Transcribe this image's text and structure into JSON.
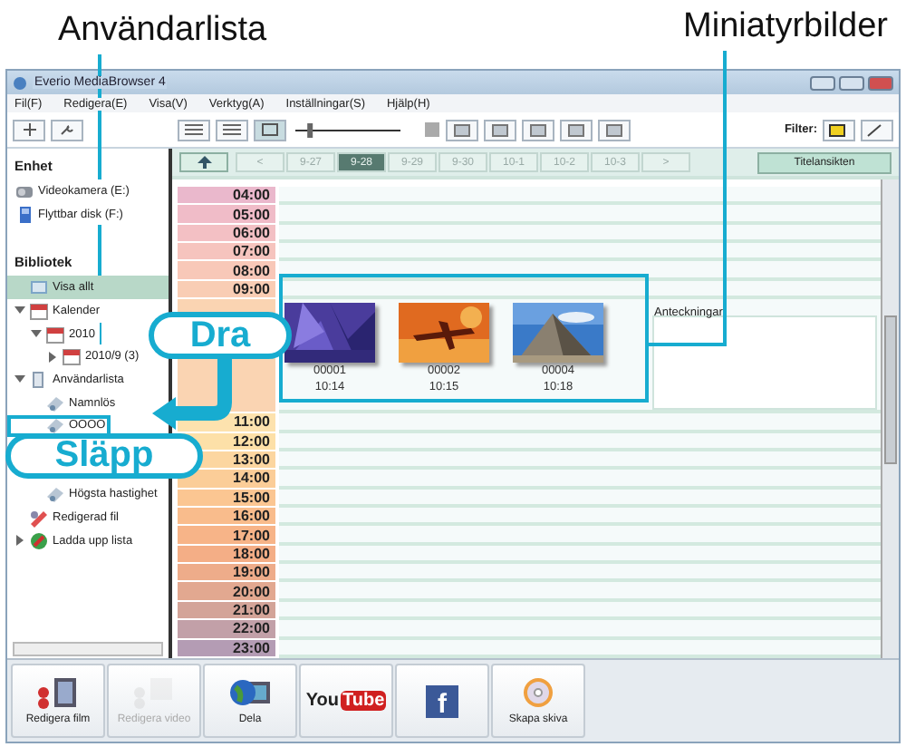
{
  "callouts": {
    "user_list": "Användarlista",
    "thumbnails": "Miniatyrbilder",
    "drag": "Dra",
    "drop": "Släpp"
  },
  "window": {
    "title": "Everio MediaBrowser 4"
  },
  "menu": [
    "Fil(F)",
    "Redigera(E)",
    "Visa(V)",
    "Verktyg(A)",
    "Inställningar(S)",
    "Hjälp(H)"
  ],
  "toolbar": {
    "filter_label": "Filter:",
    "zoom": {
      "level": 0.12
    }
  },
  "sidebar": {
    "sections": [
      {
        "title": "Enhet",
        "items": [
          {
            "label": "Videokamera (E:)",
            "kind": "camera",
            "selected": false
          },
          {
            "label": "Flyttbar disk (F:)",
            "kind": "disk",
            "selected": false
          }
        ]
      },
      {
        "title": "Bibliotek",
        "items": [
          {
            "label": "Visa allt",
            "kind": "all",
            "selected": true
          },
          {
            "label": "Kalender",
            "kind": "calendar",
            "selected": false,
            "expanded": true,
            "children": [
              {
                "label": "2010",
                "kind": "calendar",
                "selected": false,
                "expanded": true,
                "children": [
                  {
                    "label": "2010/9 (3)",
                    "kind": "calendar",
                    "selected": false,
                    "expanded": false
                  }
                ]
              }
            ]
          },
          {
            "label": "Användarlista",
            "kind": "userlist",
            "selected": false,
            "expanded": true,
            "children": [
              {
                "label": "Namnlös",
                "kind": "list",
                "selected": false
              },
              {
                "label": "OOOO",
                "kind": "list",
                "selected": false,
                "drop_target": true
              }
            ]
          },
          {
            "kind": "covered"
          },
          {
            "kind": "covered"
          },
          {
            "label": "Högsta hastighet",
            "kind": "list",
            "selected": false,
            "indent": true
          },
          {
            "label": "Redigerad fil",
            "kind": "edit",
            "selected": false
          },
          {
            "label": "Ladda upp lista",
            "kind": "upload",
            "selected": false,
            "expanded": false
          }
        ]
      }
    ]
  },
  "date_tabs": [
    {
      "label": "<",
      "selected": false
    },
    {
      "label": "9-27",
      "selected": false
    },
    {
      "label": "9-28",
      "selected": true
    },
    {
      "label": "9-29",
      "selected": false
    },
    {
      "label": "9-30",
      "selected": false
    },
    {
      "label": "10-1",
      "selected": false
    },
    {
      "label": "10-2",
      "selected": false
    },
    {
      "label": "10-3",
      "selected": false
    },
    {
      "label": ">",
      "selected": false
    }
  ],
  "face_button": "Titelansikten",
  "timeline": [
    {
      "time": "04:00",
      "color": "#eab8cc"
    },
    {
      "time": "05:00",
      "color": "#f0bcc8"
    },
    {
      "time": "06:00",
      "color": "#f3c0c4"
    },
    {
      "time": "07:00",
      "color": "#f6c4be"
    },
    {
      "time": "08:00",
      "color": "#f8c8b8"
    },
    {
      "time": "09:00",
      "color": "#f9cdb4"
    },
    {
      "color": "#fad4b2",
      "thumbnails": [
        {
          "name": "00001",
          "time": "10:14"
        },
        {
          "name": "00002",
          "time": "10:15"
        },
        {
          "name": "00004",
          "time": "10:18"
        }
      ],
      "notes_label": "Anteckningar"
    },
    {
      "time": "11:00",
      "color": "#fde2ae"
    },
    {
      "time": "12:00",
      "color": "#fde0a8"
    },
    {
      "time": "13:00",
      "color": "#fcd6a0"
    },
    {
      "time": "14:00",
      "color": "#fbcd98"
    },
    {
      "time": "15:00",
      "color": "#fbc692"
    },
    {
      "time": "16:00",
      "color": "#f9bc8c"
    },
    {
      "time": "17:00",
      "color": "#f7b488"
    },
    {
      "time": "18:00",
      "color": "#f4ae86"
    },
    {
      "time": "19:00",
      "color": "#eeac8a"
    },
    {
      "time": "20:00",
      "color": "#e2a890"
    },
    {
      "time": "21:00",
      "color": "#d3a498"
    },
    {
      "time": "22:00",
      "color": "#c2a0a8"
    },
    {
      "time": "23:00",
      "color": "#b49cb4"
    }
  ],
  "bottom_buttons": [
    {
      "kind": "edit_movie",
      "label": "Redigera film",
      "disabled": false
    },
    {
      "kind": "edit_clip",
      "label": "Redigera video",
      "disabled": true
    },
    {
      "kind": "share",
      "label": "Dela",
      "disabled": false
    },
    {
      "kind": "youtube",
      "logo_text": [
        "You",
        "Tube"
      ],
      "disabled": false
    },
    {
      "kind": "facebook",
      "logo_text": [
        "f"
      ],
      "disabled": false
    },
    {
      "kind": "disc",
      "label": "Skapa skiva",
      "disabled": false
    }
  ]
}
